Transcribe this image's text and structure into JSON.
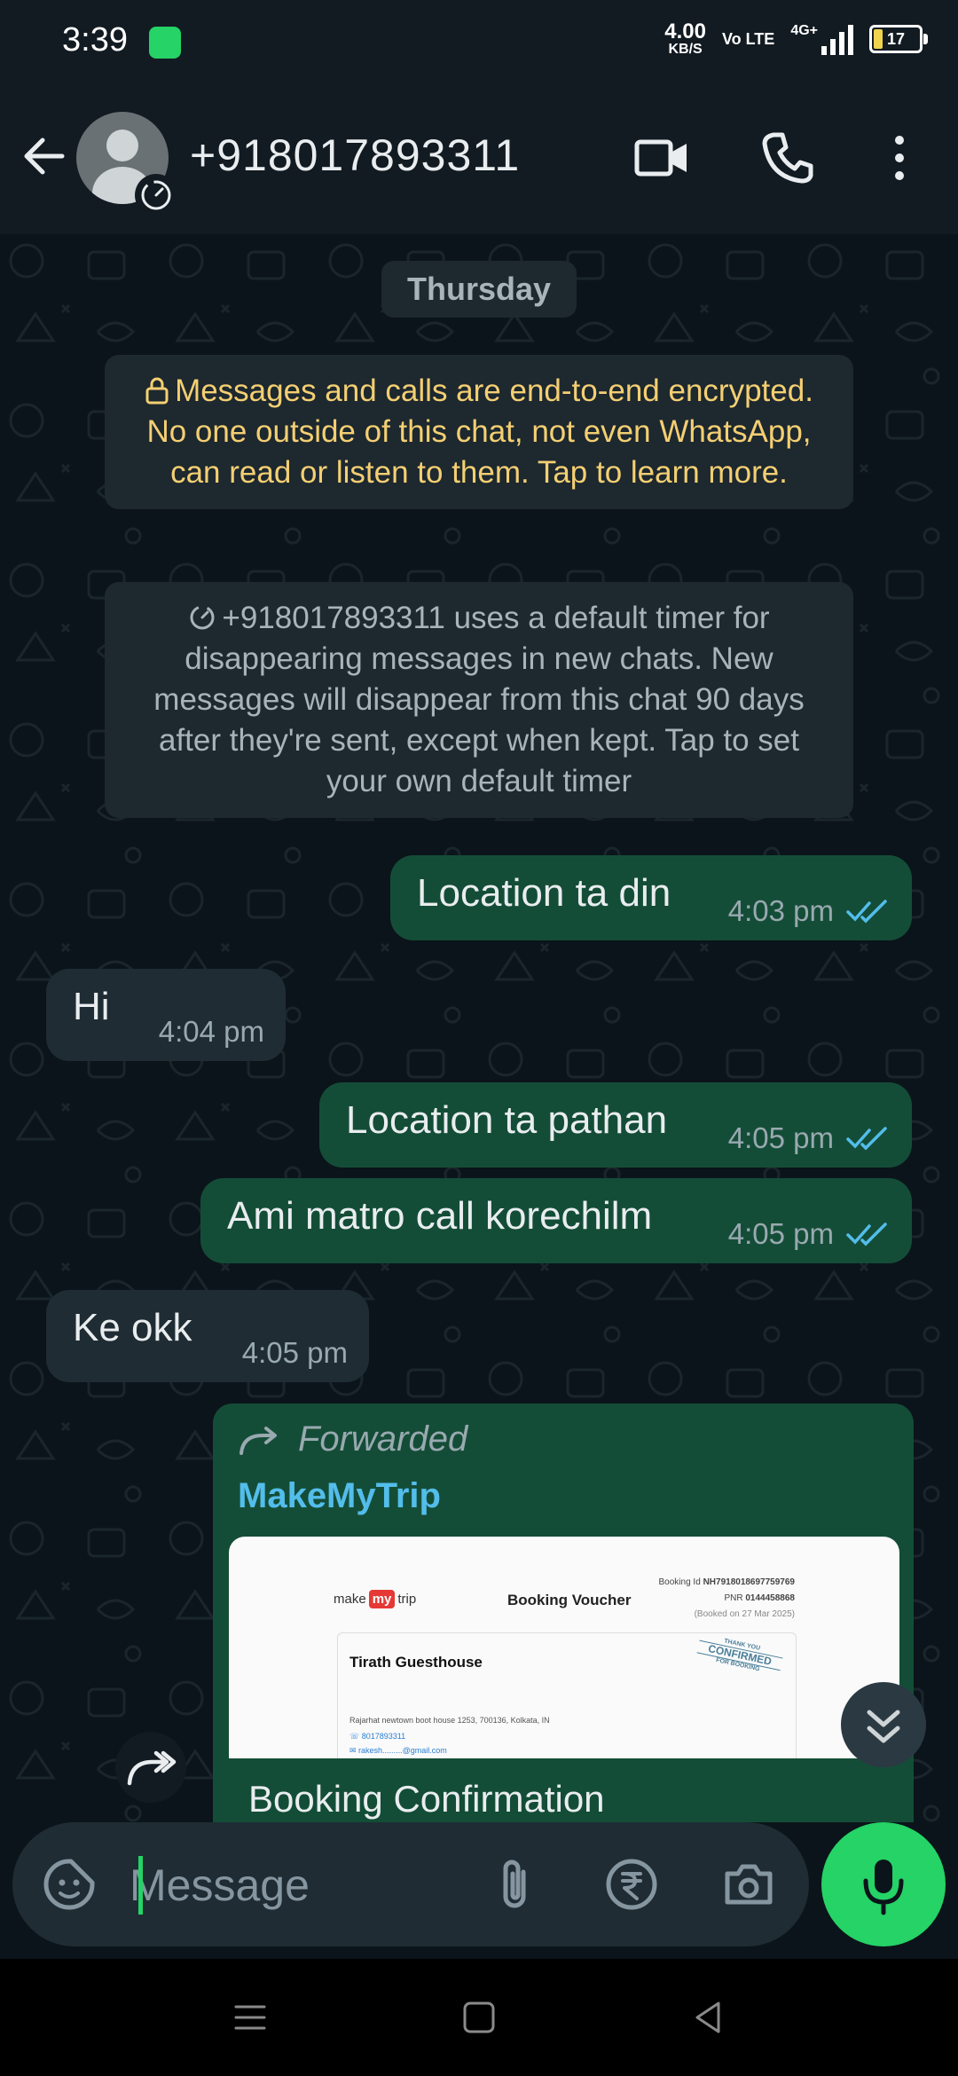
{
  "status_bar": {
    "time": "3:39",
    "net_speed_value": "4.00",
    "net_speed_unit": "KB/S",
    "volte": "Vo LTE",
    "network": "4G+",
    "battery": "17"
  },
  "header": {
    "contact_name": "+918017893311"
  },
  "chat": {
    "day_chip": "Thursday",
    "encryption_notice": "Messages and calls are end-to-end encrypted. No one outside of this chat, not even WhatsApp, can read or listen to them. Tap to learn more.",
    "timer_notice": "+918017893311 uses a default timer for disappearing messages in new chats. New messages will disappear from this chat 90 days after they're sent, except when kept. Tap to set your own default timer",
    "messages": [
      {
        "direction": "out",
        "text": "Location ta din",
        "time": "4:03 pm",
        "status": "read"
      },
      {
        "direction": "in",
        "text": "Hi",
        "time": "4:04 pm"
      },
      {
        "direction": "out",
        "text": "Location ta pathan",
        "time": "4:05 pm",
        "status": "read"
      },
      {
        "direction": "out",
        "text": "Ami matro call korechilm",
        "time": "4:05 pm",
        "status": "read"
      },
      {
        "direction": "in",
        "text": "Ke okk",
        "time": "4:05 pm"
      }
    ],
    "forwarded": {
      "label": "Forwarded",
      "sender": "MakeMyTrip",
      "caption": "Booking Confirmation",
      "voucher": {
        "brand_left": "make",
        "brand_mid": "my",
        "brand_right": "trip",
        "title": "Booking Voucher",
        "booking_id": "Booking Id",
        "booking_id_value": "NH7918018697759769",
        "pnr": "PNR",
        "pnr_value": "0144458868",
        "booked_on": "(Booked on 27 Mar 2025)",
        "hotel": "Tirath Guesthouse",
        "stamp_line1": "THANK YOU",
        "stamp_line2": "CONFIRMED",
        "stamp_line3": "FOR BOOKING",
        "address": "Rajarhat newtown boot house 1253, 700136, Kolkata, IN",
        "phone": "8017893311",
        "email": "rakesh.........@gmail.com"
      }
    }
  },
  "composer": {
    "placeholder": "Message"
  },
  "colors": {
    "accent": "#25d366",
    "outgoing_bubble": "#144d37",
    "incoming_bubble": "#1f2c34",
    "read_ticks": "#53bdeb",
    "encryption_text": "#f4cf72"
  }
}
